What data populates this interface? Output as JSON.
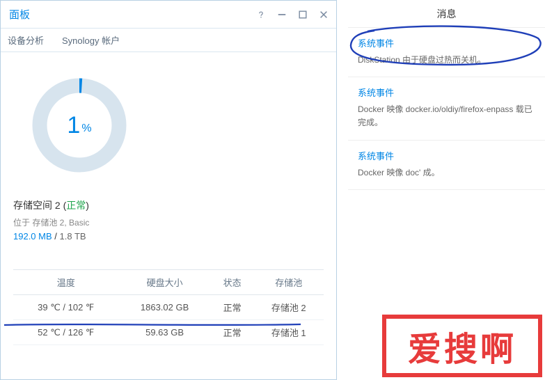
{
  "window": {
    "title": "面板"
  },
  "tabs": {
    "analysis": "设备分析",
    "account": "Synology 帐户"
  },
  "chart_data": {
    "type": "pie",
    "title": "",
    "values": [
      1,
      99
    ],
    "categories": [
      "used",
      "free"
    ],
    "display_value": "1",
    "display_unit": "%"
  },
  "volume": {
    "name": "存储空间 2",
    "status_open": "(",
    "status": "正常",
    "status_close": ")",
    "location": "位于 存储池 2, Basic",
    "used": "192.0 MB",
    "sep": " / ",
    "total": "1.8 TB"
  },
  "table": {
    "headers": {
      "temp": "温度",
      "size": "硬盘大小",
      "status": "状态",
      "pool": "存储池"
    },
    "rows": [
      {
        "temp": "39 ℃ / 102 ℉",
        "size": "1863.02 GB",
        "status": "正常",
        "pool": "存储池 2"
      },
      {
        "temp": "52 ℃ / 126 ℉",
        "size": "59.63 GB",
        "status": "正常",
        "pool": "存储池 1"
      }
    ]
  },
  "messages": {
    "title": "消息",
    "event_label": "系统事件",
    "items": [
      {
        "body": "DiskStation 由于硬盘过热而关机。"
      },
      {
        "body": "Docker 映像 docker.io/oldiy/firefox-enpass 载已完成。"
      },
      {
        "body": "Docker 映像 doc'                                        成。"
      }
    ]
  },
  "stamp": "爱搜啊"
}
